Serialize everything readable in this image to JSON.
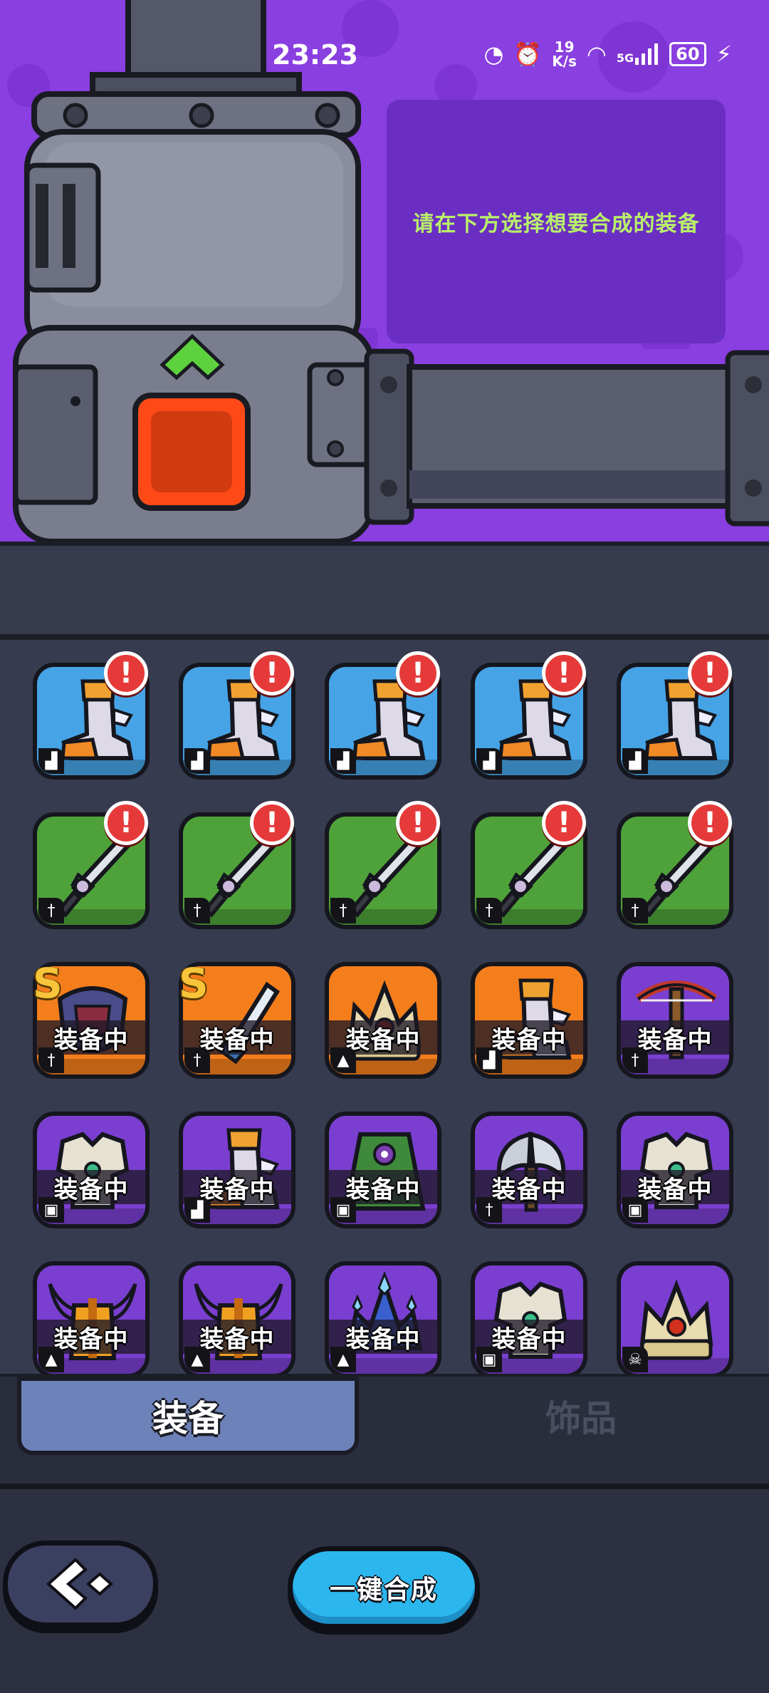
{
  "status_bar": {
    "time": "23:23",
    "net_speed_value": "19",
    "net_speed_unit": "K/s",
    "signal_label": "5G",
    "battery": "60"
  },
  "info_panel": {
    "text": "请在下方选择想要合成的装备"
  },
  "colors": {
    "top_bg": "#8a3fe0",
    "panel_bg": "#6b2ec3",
    "panel_text": "#b9f06a",
    "grid_bg": "#363b4f",
    "merge_button": "#2bb6ee"
  },
  "grid": {
    "equipped_label": "装备中",
    "alert_symbol": "!",
    "grade_symbol": "S",
    "rows": [
      [
        {
          "item": "boots-icon",
          "bg": "blue",
          "alert": true,
          "slot": "boot-slot-icon"
        },
        {
          "item": "boots-icon",
          "bg": "blue",
          "alert": true,
          "slot": "boot-slot-icon"
        },
        {
          "item": "boots-icon",
          "bg": "blue",
          "alert": true,
          "slot": "boot-slot-icon"
        },
        {
          "item": "boots-icon",
          "bg": "blue",
          "alert": true,
          "slot": "boot-slot-icon"
        },
        {
          "item": "boots-icon",
          "bg": "blue",
          "alert": true,
          "slot": "boot-slot-icon"
        }
      ],
      [
        {
          "item": "sword-icon",
          "bg": "green",
          "alert": true,
          "slot": "sword-slot-icon"
        },
        {
          "item": "sword-icon",
          "bg": "green",
          "alert": true,
          "slot": "sword-slot-icon"
        },
        {
          "item": "sword-icon",
          "bg": "green",
          "alert": true,
          "slot": "sword-slot-icon"
        },
        {
          "item": "sword-icon",
          "bg": "green",
          "alert": true,
          "slot": "sword-slot-icon"
        },
        {
          "item": "sword-icon",
          "bg": "green",
          "alert": true,
          "slot": "sword-slot-icon"
        }
      ],
      [
        {
          "item": "shield-icon",
          "bg": "orange",
          "equipped": true,
          "grade": true,
          "slot": "sword-slot-icon"
        },
        {
          "item": "blade-icon",
          "bg": "orange",
          "equipped": true,
          "grade": true,
          "slot": "sword-slot-icon"
        },
        {
          "item": "crown-icon",
          "bg": "orange",
          "equipped": true,
          "slot": "helmet-slot-icon"
        },
        {
          "item": "boots-icon",
          "bg": "orange",
          "equipped": true,
          "slot": "boot-slot-icon"
        },
        {
          "item": "crossbow-icon",
          "bg": "purple",
          "equipped": true,
          "slot": "sword-slot-icon"
        }
      ],
      [
        {
          "item": "armor-icon",
          "bg": "purple",
          "equipped": true,
          "slot": "armor-slot-icon"
        },
        {
          "item": "boots-icon",
          "bg": "purple",
          "equipped": true,
          "slot": "boot-slot-icon"
        },
        {
          "item": "cloak-icon",
          "bg": "purple",
          "equipped": true,
          "slot": "armor-slot-icon"
        },
        {
          "item": "axe-icon",
          "bg": "purple",
          "equipped": true,
          "slot": "sword-slot-icon"
        },
        {
          "item": "armor-icon",
          "bg": "purple",
          "equipped": true,
          "slot": "armor-slot-icon"
        }
      ],
      [
        {
          "item": "horned-helmet-icon",
          "bg": "purple",
          "equipped": true,
          "slot": "helmet-slot-icon"
        },
        {
          "item": "horned-helmet-icon",
          "bg": "purple",
          "equipped": true,
          "slot": "helmet-slot-icon"
        },
        {
          "item": "crystal-crown-icon",
          "bg": "purple",
          "equipped": true,
          "slot": "helmet-slot-icon"
        },
        {
          "item": "armor-icon",
          "bg": "purple",
          "equipped": true,
          "slot": "armor-slot-icon"
        },
        {
          "item": "crown-icon",
          "bg": "purple",
          "equipped": false,
          "slot": "skull-slot-icon"
        }
      ]
    ]
  },
  "tabs": {
    "equipment": "装备",
    "accessory": "饰品",
    "selected": "equipment"
  },
  "buttons": {
    "merge_all": "一键合成",
    "back_icon": "back-arrow-icon"
  }
}
